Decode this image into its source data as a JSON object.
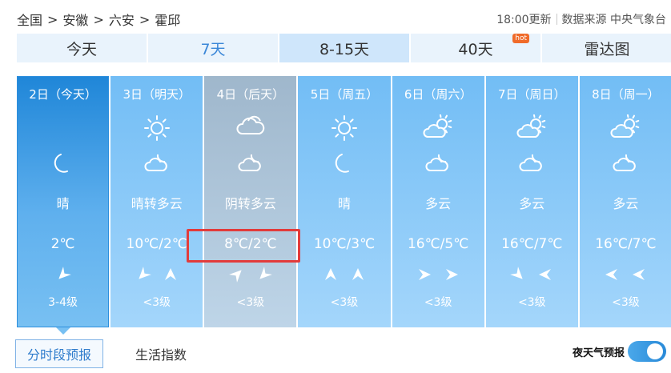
{
  "breadcrumb": {
    "items": [
      "全国",
      "安徽",
      "六安",
      "霍邱"
    ],
    "separator": ">"
  },
  "meta": {
    "update": "18:00更新",
    "source": "数据来源 中央气象台"
  },
  "tabs": [
    {
      "label": "今天"
    },
    {
      "label": "7天"
    },
    {
      "label": "8-15天"
    },
    {
      "label": "40天",
      "badge": "hot"
    },
    {
      "label": "雷达图"
    }
  ],
  "days": [
    {
      "date": "2日（今天）",
      "icons": [
        "moon-icon"
      ],
      "condition": "晴",
      "temp": "2℃",
      "wind_dirs": [
        "southwest"
      ],
      "wind_level": "3-4级"
    },
    {
      "date": "3日（明天）",
      "icons": [
        "sun-icon",
        "cloudy-night-icon"
      ],
      "condition": "晴转多云",
      "temp": "10℃/2℃",
      "wind_dirs": [
        "southwest",
        "north"
      ],
      "wind_level": "<3级"
    },
    {
      "date": "4日（后天）",
      "icons": [
        "overcast-icon",
        "cloudy-night-icon"
      ],
      "condition": "阴转多云",
      "temp": "8℃/2℃",
      "wind_dirs": [
        "northeast",
        "southwest"
      ],
      "wind_level": "<3级"
    },
    {
      "date": "5日（周五）",
      "icons": [
        "sun-icon",
        "moon-icon"
      ],
      "condition": "晴",
      "temp": "10℃/3℃",
      "wind_dirs": [
        "north",
        "north"
      ],
      "wind_level": "<3级"
    },
    {
      "date": "6日（周六）",
      "icons": [
        "partly-cloudy-day-icon",
        "cloudy-night-icon"
      ],
      "condition": "多云",
      "temp": "16℃/5℃",
      "wind_dirs": [
        "east",
        "east"
      ],
      "wind_level": "<3级"
    },
    {
      "date": "7日（周日）",
      "icons": [
        "partly-cloudy-day-icon",
        "cloudy-night-icon"
      ],
      "condition": "多云",
      "temp": "16℃/7℃",
      "wind_dirs": [
        "southeast",
        "west"
      ],
      "wind_level": "<3级"
    },
    {
      "date": "8日（周一）",
      "icons": [
        "partly-cloudy-day-icon",
        "cloudy-night-icon"
      ],
      "condition": "多云",
      "temp": "16℃/7℃",
      "wind_dirs": [
        "west",
        "west"
      ],
      "wind_level": "<3级"
    }
  ],
  "bottom_tabs": [
    {
      "label": "分时段预报"
    },
    {
      "label": "生活指数"
    }
  ],
  "tonight": {
    "label": "夜天气预报"
  },
  "colors": {
    "highlight": "#e23b3b",
    "accent": "#3b87d8"
  }
}
